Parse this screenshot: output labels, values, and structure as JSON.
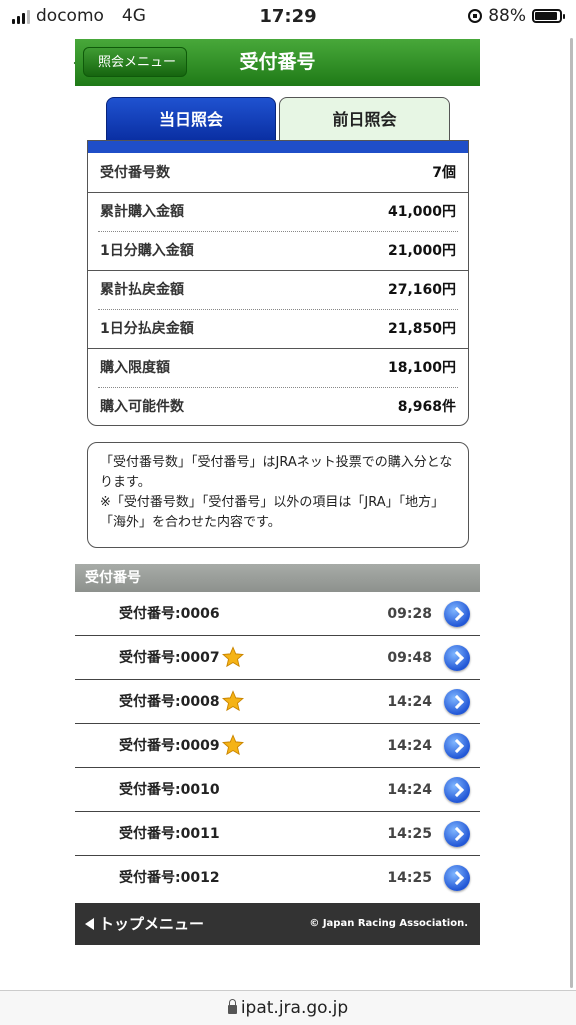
{
  "status_bar": {
    "carrier": "docomo",
    "network": "4G",
    "time": "17:29",
    "battery": "88%"
  },
  "header": {
    "back_label": "照会メニュー",
    "title": "受付番号"
  },
  "tabs": [
    {
      "label": "当日照会",
      "active": true
    },
    {
      "label": "前日照会",
      "active": false
    }
  ],
  "summary": [
    {
      "label": "受付番号数",
      "value": "7個"
    },
    {
      "label": "累計購入金額",
      "value": "41,000円"
    },
    {
      "label": "1日分購入金額",
      "value": "21,000円"
    },
    {
      "label": "累計払戻金額",
      "value": "27,160円"
    },
    {
      "label": "1日分払戻金額",
      "value": "21,850円"
    },
    {
      "label": "購入限度額",
      "value": "18,100円"
    },
    {
      "label": "購入可能件数",
      "value": "8,968件"
    }
  ],
  "note": {
    "line1": "「受付番号数」「受付番号」はJRAネット投票での購入分となります。",
    "line2": "※「受付番号数」「受付番号」以外の項目は「JRA」「地方」「海外」を合わせた内容です。"
  },
  "list": {
    "header": "受付番号",
    "items": [
      {
        "label": "受付番号:0006",
        "time": "09:28",
        "starred": false
      },
      {
        "label": "受付番号:0007",
        "time": "09:48",
        "starred": true
      },
      {
        "label": "受付番号:0008",
        "time": "14:24",
        "starred": true
      },
      {
        "label": "受付番号:0009",
        "time": "14:24",
        "starred": true
      },
      {
        "label": "受付番号:0010",
        "time": "14:24",
        "starred": false
      },
      {
        "label": "受付番号:0011",
        "time": "14:25",
        "starred": false
      },
      {
        "label": "受付番号:0012",
        "time": "14:25",
        "starred": false
      }
    ]
  },
  "footer": {
    "home_label": "トップメニュー",
    "copyright": "© Japan Racing Association."
  },
  "url": "ipat.jra.go.jp",
  "colors": {
    "header_green": "#1f7a17",
    "tab_blue": "#0a2fa3",
    "tab_inactive": "#e7f6e4",
    "footer": "#333333"
  }
}
